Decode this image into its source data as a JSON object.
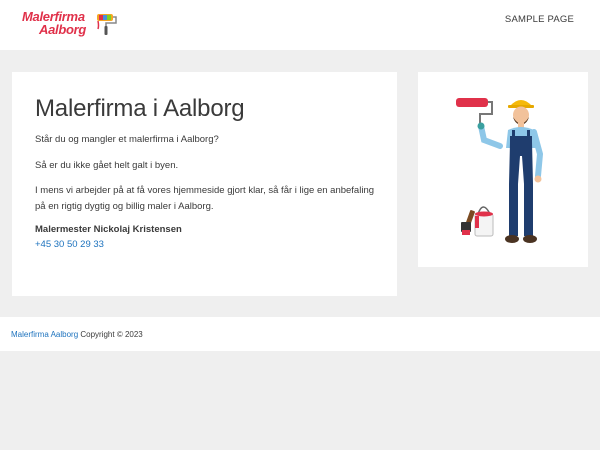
{
  "header": {
    "logo": {
      "line1": "Malerfirma",
      "line2": "Aalborg",
      "icon": "paint-roller-icon",
      "color": "#e0314a"
    },
    "nav": {
      "sample_page": "SAMPLE PAGE"
    }
  },
  "main": {
    "title": "Malerfirma i Aalborg",
    "paragraphs": [
      "Står du og mangler et malerfirma i Aalborg?",
      "Så er du ikke gået helt galt i byen.",
      "I mens vi arbejder på at få vores hjemmeside gjort klar, så får i lige en anbefaling på en rigtig dygtig og billig maler i Aalborg."
    ],
    "signature": "Malermester Nickolaj Kristensen",
    "phone": "+45 30 50 29 33"
  },
  "sidebar": {
    "image": "painter-illustration"
  },
  "footer": {
    "site_link": "Malerfirma Aalborg",
    "copyright": " Copyright © 2023"
  },
  "colors": {
    "background": "#efefef",
    "card": "#ffffff",
    "link": "#1e73be",
    "text": "#3a3a3a",
    "brand": "#e0314a"
  }
}
